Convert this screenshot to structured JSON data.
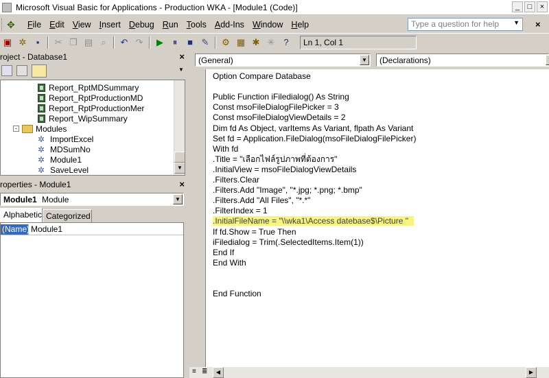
{
  "window": {
    "title": "Microsoft Visual Basic for Applications - Production WKA - [Module1 (Code)]",
    "buttons": [
      "_",
      "□",
      "×"
    ]
  },
  "menu": {
    "items": [
      {
        "label": "File",
        "u": "F",
        "rest": "ile"
      },
      {
        "label": "Edit",
        "u": "E",
        "rest": "dit"
      },
      {
        "label": "View",
        "u": "V",
        "rest": "iew"
      },
      {
        "label": "Insert",
        "u": "I",
        "rest": "nsert"
      },
      {
        "label": "Debug",
        "u": "D",
        "rest": "ebug"
      },
      {
        "label": "Run",
        "u": "R",
        "rest": "un"
      },
      {
        "label": "Tools",
        "u": "T",
        "rest": "ools"
      },
      {
        "label": "Add-Ins",
        "u": "A",
        "rest": "dd-Ins"
      },
      {
        "label": "Window",
        "u": "W",
        "rest": "indow"
      },
      {
        "label": "Help",
        "u": "H",
        "rest": "elp"
      }
    ],
    "help_placeholder": "Type a question for help",
    "close": "×"
  },
  "toolbar": {
    "position": "Ln 1, Col 1"
  },
  "project": {
    "header": "roject - Database1",
    "close": "×",
    "tree": [
      {
        "type": "report",
        "label": "Report_RptMDSummary"
      },
      {
        "type": "report",
        "label": "Report_RptProductionMD"
      },
      {
        "type": "report",
        "label": "Report_RptProductionMer"
      },
      {
        "type": "report",
        "label": "Report_WipSummary"
      },
      {
        "type": "folder",
        "label": "Modules"
      },
      {
        "type": "module",
        "label": "ImportExcel"
      },
      {
        "type": "module",
        "label": "MDSumNo"
      },
      {
        "type": "module",
        "label": "Module1"
      },
      {
        "type": "module",
        "label": "SaveLevel"
      }
    ]
  },
  "properties": {
    "header": "roperties - Module1",
    "close": "×",
    "object_bold": "Module1",
    "object_type": "Module",
    "tabs": [
      "Alphabetic",
      "Categorized"
    ],
    "row_name": "(Name)",
    "row_value": "Module1"
  },
  "code": {
    "object_combo": "(General)",
    "proc_combo": "(Declarations)",
    "lines": [
      "Option Compare Database",
      "",
      "Public Function iFiledialog() As String",
      "Const msoFileDialogFilePicker = 3",
      "Const msoFileDialogViewDetails = 2",
      "Dim fd As Object, varItems As Variant, flpath As Variant",
      "Set fd = Application.FileDialog(msoFileDialogFilePicker)",
      "With fd",
      ".Title = \"เลือกไฟล์รูปภาพที่ต้องการ\"",
      ".InitialView = msoFileDialogViewDetails",
      ".Filters.Clear",
      ".Filters.Add \"Image\", \"*.jpg; *.png; *.bmp\"",
      ".Filters.Add \"All Files\", \"*.*\"",
      ".FilterIndex = 1",
      ".InitialFileName = \"\\\\wka1\\Access datebase$\\Picture \"",
      "If fd.Show = True Then",
      "iFiledialog = Trim(.SelectedItems.Item(1))",
      "End If",
      "End With",
      "",
      "",
      "End Function"
    ],
    "highlight_line": 14,
    "highlight_color": "#f5f580"
  }
}
